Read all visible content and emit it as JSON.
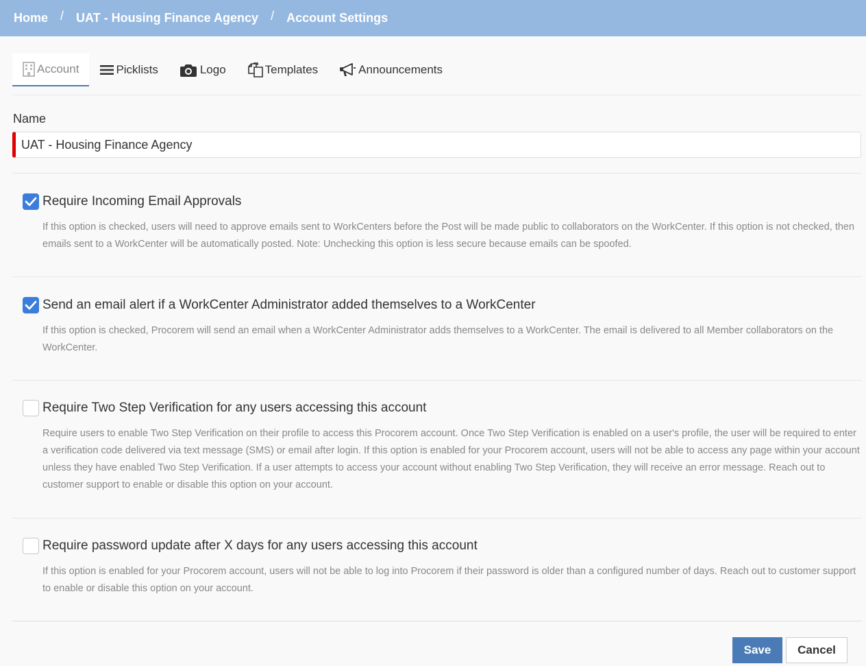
{
  "breadcrumb": {
    "items": [
      "Home",
      "UAT - Housing Finance Agency",
      "Account Settings"
    ],
    "separator": "/"
  },
  "tabs": [
    {
      "label": "Account",
      "icon": "building-icon",
      "active": true
    },
    {
      "label": "Picklists",
      "icon": "list-icon",
      "active": false
    },
    {
      "label": "Logo",
      "icon": "camera-icon",
      "active": false
    },
    {
      "label": "Templates",
      "icon": "copy-icon",
      "active": false
    },
    {
      "label": "Announcements",
      "icon": "bullhorn-icon",
      "active": false
    }
  ],
  "form": {
    "name_label": "Name",
    "name_value": "UAT - Housing Finance Agency"
  },
  "options": [
    {
      "title": "Require Incoming Email Approvals",
      "checked": true,
      "description": "If this option is checked, users will need to approve emails sent to WorkCenters before the Post will be made public to collaborators on the WorkCenter. If this option is not checked, then emails sent to a WorkCenter will be automatically posted. Note: Unchecking this option is less secure because emails can be spoofed."
    },
    {
      "title": "Send an email alert if a WorkCenter Administrator added themselves to a WorkCenter",
      "checked": true,
      "description": "If this option is checked, Procorem will send an email when a WorkCenter Administrator adds themselves to a WorkCenter. The email is delivered to all Member collaborators on the WorkCenter."
    },
    {
      "title": "Require Two Step Verification for any users accessing this account",
      "checked": false,
      "description": "Require users to enable Two Step Verification on their profile to access this Procorem account. Once Two Step Verification is enabled on a user's profile, the user will be required to enter a verification code delivered via text message (SMS) or email after login. If this option is enabled for your Procorem account, users will not be able to access any page within your account unless they have enabled Two Step Verification. If a user attempts to access your account without enabling Two Step Verification, they will receive an error message. Reach out to customer support to enable or disable this option on your account."
    },
    {
      "title": "Require password update after X days for any users accessing this account",
      "checked": false,
      "description": "If this option is enabled for your Procorem account, users will not be able to log into Procorem if their password is older than a configured number of days. Reach out to customer support to enable or disable this option on your account."
    }
  ],
  "actions": {
    "save_label": "Save",
    "cancel_label": "Cancel"
  },
  "colors": {
    "header": "#95b8e0",
    "accent": "#4a7bb7",
    "checkbox_on": "#3b7ddd",
    "required_marker": "#e00000"
  }
}
